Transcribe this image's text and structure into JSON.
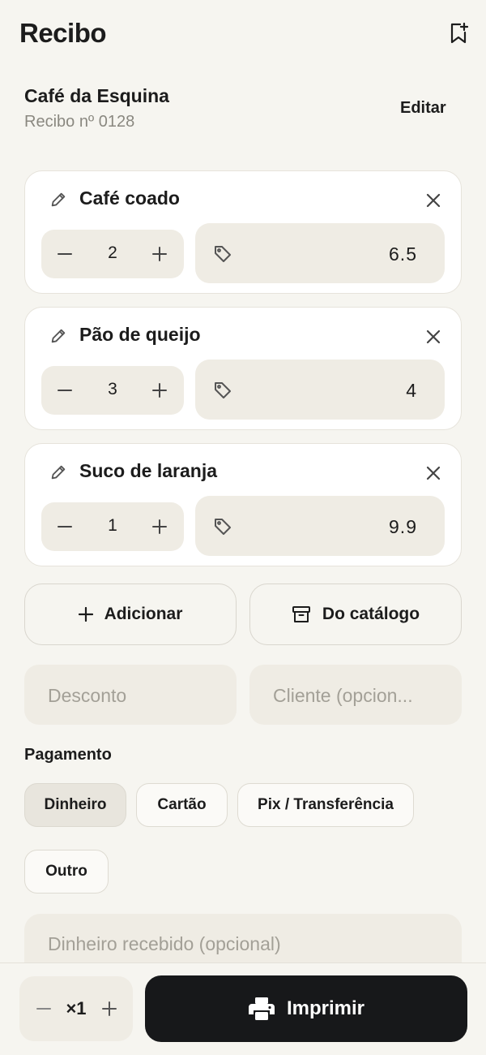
{
  "header": {
    "title": "Recibo",
    "bookmark_icon": "bookmark-plus-icon"
  },
  "shop": {
    "name": "Café da Esquina",
    "receipt_number": "Recibo nº 0128",
    "edit_label": "Editar"
  },
  "items": [
    {
      "name": "Café coado",
      "quantity": "2",
      "price": "6.5"
    },
    {
      "name": "Pão de queijo",
      "quantity": "3",
      "price": "4"
    },
    {
      "name": "Suco de laranja",
      "quantity": "1",
      "price": "9.9"
    }
  ],
  "actions": {
    "add_label": "Adicionar",
    "catalog_label": "Do catálogo"
  },
  "fields": {
    "discount_placeholder": "Desconto",
    "client_placeholder": "Cliente (opcion..."
  },
  "payment": {
    "label": "Pagamento",
    "options": [
      "Dinheiro",
      "Cartão",
      "Pix / Transferência",
      "Outro"
    ],
    "selected": "Dinheiro",
    "cash_received_placeholder": "Dinheiro recebido (opcional)"
  },
  "footer": {
    "copies": "×1",
    "print_label": "Imprimir"
  },
  "colors": {
    "background": "#f6f5f0",
    "field_bg": "#efece4",
    "primary_button": "#17181a"
  }
}
